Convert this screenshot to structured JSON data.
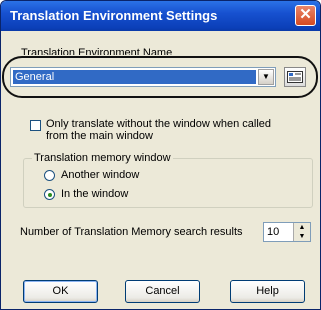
{
  "window": {
    "title": "Translation Environment Settings",
    "close_glyph": "✕"
  },
  "env_name": {
    "label": "Translation Environment Name",
    "selected": "General",
    "arrow": "▼",
    "edit_icon": "edit-icon"
  },
  "only_translate": {
    "line1": "Only translate without the window when called",
    "line2": "from the main window",
    "checked": false
  },
  "memory_group": {
    "title": "Translation memory window",
    "options": [
      {
        "label": "Another window",
        "selected": false
      },
      {
        "label": "In the window",
        "selected": true
      }
    ]
  },
  "search_results": {
    "label": "Number of Translation Memory search results",
    "value": "10"
  },
  "buttons": {
    "ok": "OK",
    "cancel": "Cancel",
    "help": "Help"
  },
  "colors": {
    "accent": "#316ac5",
    "highlight_oval": "#111111"
  }
}
